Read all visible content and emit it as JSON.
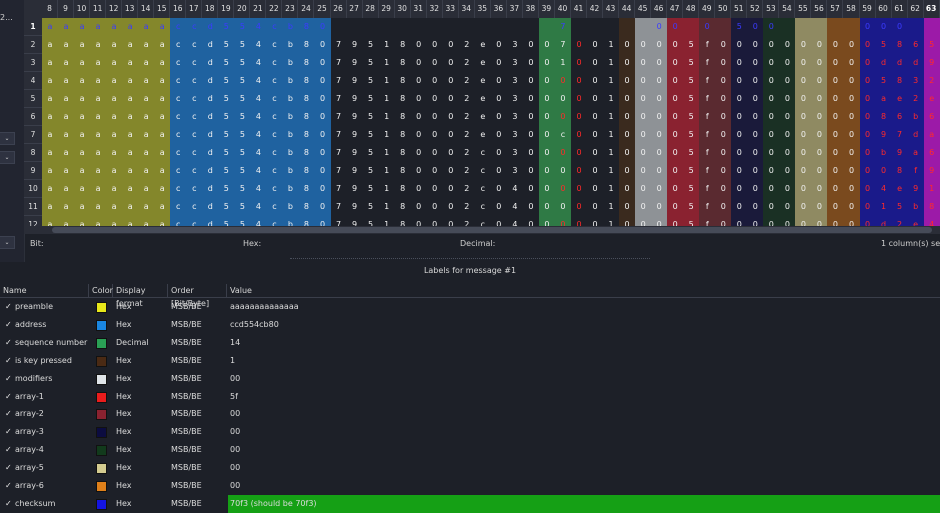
{
  "left_panel": {
    "title_fragment": "2...",
    "combo_glyph": "⌄"
  },
  "table": {
    "columns": [
      "8",
      "9",
      "10",
      "11",
      "12",
      "13",
      "14",
      "15",
      "16",
      "17",
      "18",
      "19",
      "20",
      "21",
      "22",
      "23",
      "24",
      "25",
      "26",
      "27",
      "28",
      "29",
      "30",
      "31",
      "32",
      "33",
      "34",
      "35",
      "36",
      "37",
      "38",
      "39",
      "40",
      "41",
      "42",
      "43",
      "44",
      "45",
      "46",
      "47",
      "48",
      "49",
      "50",
      "51",
      "52",
      "53",
      "54",
      "55",
      "56",
      "57",
      "58",
      "59",
      "60",
      "61",
      "62",
      "63"
    ],
    "selected_column": "63",
    "rows": [
      "1",
      "2",
      "3",
      "4",
      "5",
      "6",
      "7",
      "8",
      "9",
      "10",
      "11",
      "12"
    ],
    "selected_row": "1",
    "column_colors": [
      "#84872b",
      "#84872b",
      "#84872b",
      "#84872b",
      "#84872b",
      "#84872b",
      "#84872b",
      "#84872b",
      "#1f62a0",
      "#1f62a0",
      "#1f62a0",
      "#1f62a0",
      "#1f62a0",
      "#1f62a0",
      "#1f62a0",
      "#1f62a0",
      "#1f62a0",
      "#1f62a0",
      "",
      "",
      "",
      "",
      "",
      "",
      "",
      "",
      "",
      "",
      "",
      "",
      "",
      "#2f7a45",
      "#2f7a45",
      "",
      "",
      "",
      "#3a2a1e",
      "#8e9296",
      "#8e9296",
      "#8a2230",
      "#8a2230",
      "#5a2a30",
      "#5a2a30",
      "#1a1a3a",
      "#1a1a3a",
      "#1a3024",
      "#1a3024",
      "#8f8a62",
      "#8f8a62",
      "#7a4a1e",
      "#7a4a1e",
      "#1a1a8a",
      "#1a1a8a",
      "#1a1a8a",
      "#1a1a8a",
      "#9c1aa8"
    ],
    "cells": [
      "aaaaaaaaccd554cb80______________7_____00_0_500_____000_____0",
      "aaaaaaaaccd554cb807951800~2e030^7!01000~5f00000000^~58650",
      "aaaaaaaaccd554cb807951800~2e030^1!01000~5f00000000^~ddd91",
      "aaaaaaaaccd554cb807951800~2e030^!!01000~5f00000000^~58328",
      "aaaaaaaaccd554cb807951800~2e030^0!01000~5f00000000^~ae2e8",
      "aaaaaaaaccd554cb807951800~2e030^!!01000~5f00000000^~86b68",
      "aaaaaaaaccd554cb807951800~2e030^c!01000~5f00000000^~97da8",
      "aaaaaaaaccd554cb807951800~2c030^!!01000~5f00000000^~b9a68",
      "aaaaaaaaccd554cb807951800~2c030^0!01000~5f00000000^~08f98",
      "aaaaaaaaccd554cb807951800~2c040^!!01000~5f00000000^~4e910",
      "aaaaaaaaccd554cb807951800~2c040^0!01000~5f00000000^~15b88",
      "aaaaaaaaccd554cb807951800~2c040^!!01000~5f00000000^~d2e48"
    ]
  },
  "status": {
    "bit_label": "Bit:",
    "hex_label": "Hex:",
    "decimal_label": "Decimal:",
    "selection": "1  column(s) selec"
  },
  "labels_panel": {
    "title": "Labels for message #1",
    "headers": {
      "name": "Name",
      "color": "Color",
      "display_format": "Display format",
      "order": "Order [Bit/Byte]",
      "value": "Value"
    },
    "check_glyph": "✓",
    "items": [
      {
        "name": "preamble",
        "color": "#e8e81a",
        "format": "Hex",
        "order": "MSB/BE",
        "value": "aaaaaaaaaaaaaa"
      },
      {
        "name": "address",
        "color": "#1a86e0",
        "format": "Hex",
        "order": "MSB/BE",
        "value": "ccd554cb80"
      },
      {
        "name": "sequence number",
        "color": "#2aa055",
        "format": "Decimal",
        "order": "MSB/BE",
        "value": "14"
      },
      {
        "name": "is key pressed",
        "color": "#4a2a14",
        "format": "Hex",
        "order": "MSB/BE",
        "value": "1"
      },
      {
        "name": "modifiers",
        "color": "#dfe4e8",
        "format": "Hex",
        "order": "MSB/BE",
        "value": "00"
      },
      {
        "name": "array-1",
        "color": "#ea1c1c",
        "format": "Hex",
        "order": "MSB/BE",
        "value": "5f"
      },
      {
        "name": "array-2",
        "color": "#8a2230",
        "format": "Hex",
        "order": "MSB/BE",
        "value": "00"
      },
      {
        "name": "array-3",
        "color": "#0c0c40",
        "format": "Hex",
        "order": "MSB/BE",
        "value": "00"
      },
      {
        "name": "array-4",
        "color": "#123a1c",
        "format": "Hex",
        "order": "MSB/BE",
        "value": "00"
      },
      {
        "name": "array-5",
        "color": "#d4cc90",
        "format": "Hex",
        "order": "MSB/BE",
        "value": "00"
      },
      {
        "name": "array-6",
        "color": "#e0801a",
        "format": "Hex",
        "order": "MSB/BE",
        "value": "00"
      },
      {
        "name": "checksum",
        "color": "#1414e0",
        "format": "Hex",
        "order": "MSB/BE",
        "value": "70f3 (should be 70f3)",
        "highlight": "#15a015"
      }
    ]
  }
}
